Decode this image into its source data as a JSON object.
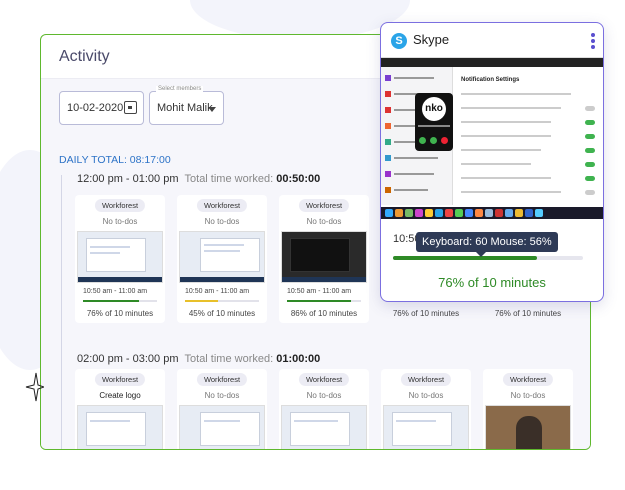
{
  "panel": {
    "title": "Activity",
    "date": "10-02-2020",
    "member_label": "Select members",
    "member": "Mohit Malik",
    "daily_total": "DAILY TOTAL: 08:17:00"
  },
  "slots": [
    {
      "range": "12:00 pm - 01:00 pm",
      "total_label": "Total time worked:",
      "total": "00:50:00",
      "cards": [
        {
          "tag": "Workforest",
          "todo": "No to-dos",
          "time": "10:50 am - 11:00 am",
          "pct": "76% of 10 minutes",
          "progress": 0.76
        },
        {
          "tag": "Workforest",
          "todo": "No to-dos",
          "time": "10:50 am - 11:00 am",
          "pct": "45% of 10 minutes",
          "progress": 0.45
        },
        {
          "tag": "Workforest",
          "todo": "No to-dos",
          "time": "10:50 am - 11:00 am",
          "pct": "86% of 10 minutes",
          "progress": 0.86
        },
        {
          "pct": "76% of 10 minutes"
        },
        {
          "pct": "76% of 10 minutes"
        }
      ]
    },
    {
      "range": "02:00 pm - 03:00 pm",
      "total_label": "Total time worked:",
      "total": "01:00:00",
      "cards": [
        {
          "tag": "Workforest",
          "todo": "Create logo"
        },
        {
          "tag": "Workforest",
          "todo": "No to-dos"
        },
        {
          "tag": "Workforest",
          "todo": "No to-dos"
        },
        {
          "tag": "Workforest",
          "todo": "No to-dos"
        },
        {
          "tag": "Workforest",
          "todo": "No to-dos"
        }
      ]
    }
  ],
  "skype": {
    "title": "Skype",
    "notification_title": "Notification Settings",
    "call_initials": "nko",
    "time": "10:50",
    "tooltip": "Keyboard: 60  Mouse: 56%",
    "progress": 0.76,
    "pct": "76% of 10 minutes"
  },
  "colors": {
    "accent_green": "#5fb82e",
    "accent_blue": "#2d73c7",
    "accent_purple": "#7b6fe0",
    "bar_green": "#2e8a26",
    "bar_yellow": "#e8c02a"
  }
}
